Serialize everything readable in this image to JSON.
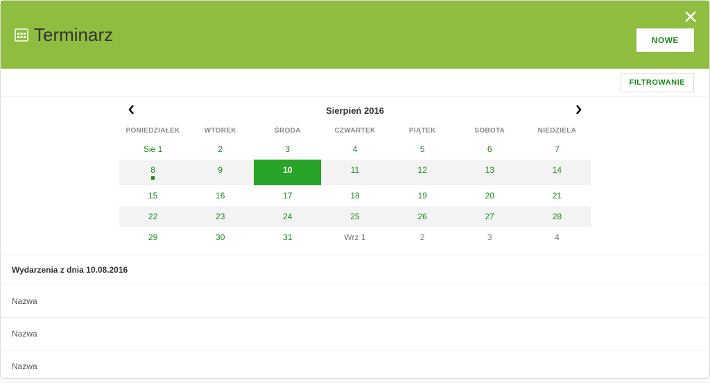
{
  "header": {
    "title": "Terminarz",
    "new_button": "NOWE",
    "filter_button": "FILTROWANIE"
  },
  "calendar": {
    "month_label": "Sierpień 2016",
    "dow": [
      "PONIEDZIAŁEK",
      "WTOREK",
      "ŚRODA",
      "CZWARTEK",
      "PIĄTEK",
      "SOBOTA",
      "NIEDZIELA"
    ],
    "weeks": [
      [
        {
          "label": "Sie 1"
        },
        {
          "label": "2"
        },
        {
          "label": "3"
        },
        {
          "label": "4"
        },
        {
          "label": "5"
        },
        {
          "label": "6"
        },
        {
          "label": "7"
        }
      ],
      [
        {
          "label": "8",
          "has_event": true
        },
        {
          "label": "9"
        },
        {
          "label": "10",
          "selected": true
        },
        {
          "label": "11"
        },
        {
          "label": "12"
        },
        {
          "label": "13"
        },
        {
          "label": "14"
        }
      ],
      [
        {
          "label": "15"
        },
        {
          "label": "16"
        },
        {
          "label": "17"
        },
        {
          "label": "18"
        },
        {
          "label": "19"
        },
        {
          "label": "20"
        },
        {
          "label": "21"
        }
      ],
      [
        {
          "label": "22"
        },
        {
          "label": "23"
        },
        {
          "label": "24"
        },
        {
          "label": "25"
        },
        {
          "label": "26"
        },
        {
          "label": "27"
        },
        {
          "label": "28"
        }
      ],
      [
        {
          "label": "29"
        },
        {
          "label": "30"
        },
        {
          "label": "31"
        },
        {
          "label": "Wrz 1",
          "muted": true
        },
        {
          "label": "2",
          "muted": true
        },
        {
          "label": "3",
          "muted": true
        },
        {
          "label": "4",
          "muted": true
        }
      ]
    ]
  },
  "events": {
    "heading": "Wydarzenia z dnia 10.08.2016",
    "items": [
      "Nazwa",
      "Nazwa",
      "Nazwa"
    ]
  }
}
